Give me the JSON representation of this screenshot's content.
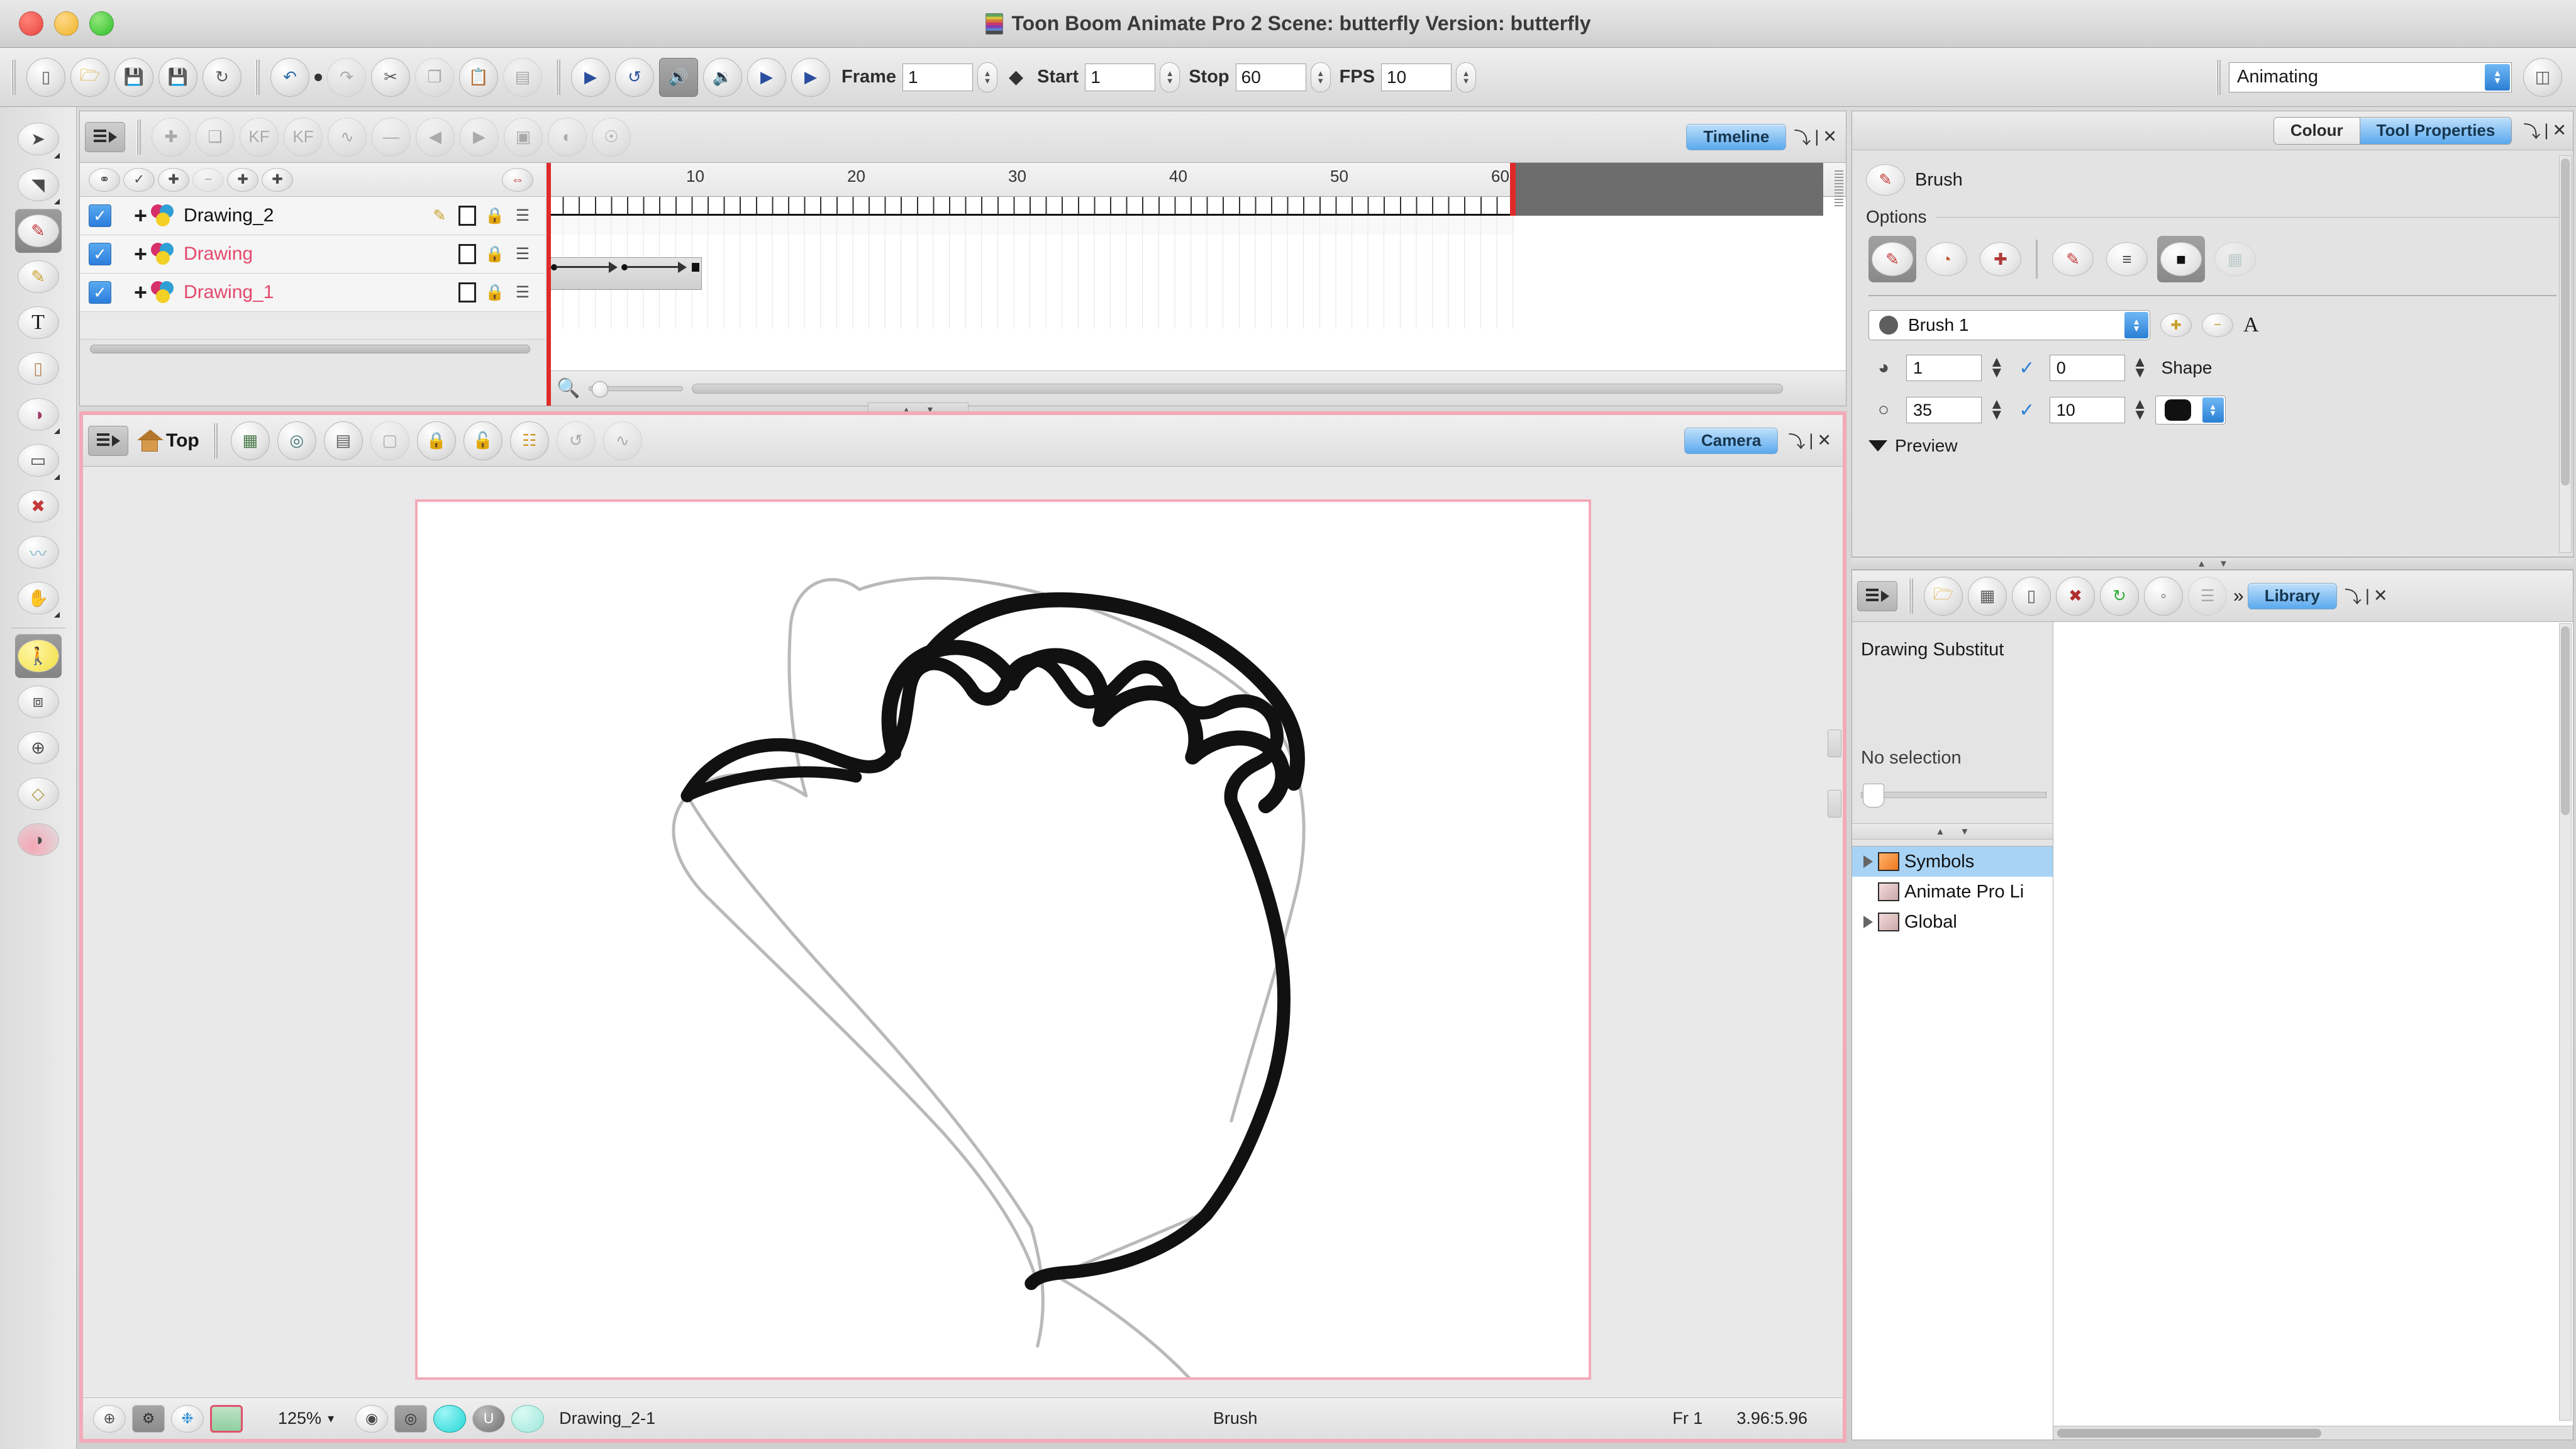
{
  "window": {
    "title": "Toon Boom Animate Pro 2 Scene: butterfly Version: butterfly",
    "close_label": "close",
    "minimize_label": "minimize",
    "zoom_label": "zoom"
  },
  "toolbar": {
    "file_buttons": [
      {
        "name": "new-scene-icon",
        "glyph": "▭"
      },
      {
        "name": "open-scene-icon",
        "glyph": "🗁"
      },
      {
        "name": "save-icon",
        "glyph": "💾"
      },
      {
        "name": "save-as-icon",
        "glyph": "💾"
      },
      {
        "name": "save-all-icon",
        "glyph": "↻"
      }
    ],
    "edit_buttons": [
      {
        "name": "undo-icon",
        "glyph": "↶"
      },
      {
        "name": "redo-icon",
        "glyph": "↷"
      },
      {
        "name": "cut-icon",
        "glyph": "✂"
      },
      {
        "name": "copy-icon",
        "glyph": "❐"
      },
      {
        "name": "paste-icon",
        "glyph": "📋"
      },
      {
        "name": "paste-special-icon",
        "glyph": "▤"
      }
    ],
    "playback_buttons": [
      {
        "name": "play-icon",
        "glyph": "▶",
        "active": false
      },
      {
        "name": "loop-icon",
        "glyph": "↺",
        "active": false
      },
      {
        "name": "sound-on-icon",
        "glyph": "🔊",
        "active": true
      },
      {
        "name": "sound-scrub-icon",
        "glyph": "🔉",
        "active": false
      },
      {
        "name": "preroll-icon",
        "glyph": "▶",
        "active": false
      },
      {
        "name": "postroll-icon",
        "glyph": "▶",
        "active": false
      }
    ],
    "frame_label": "Frame",
    "frame_value": "1",
    "start_label": "Start",
    "start_value": "1",
    "stop_label": "Stop",
    "stop_value": "60",
    "fps_label": "FPS",
    "fps_value": "10",
    "mode_value": "Animating",
    "workspace_icon": "workspace-icon"
  },
  "left_tools": [
    {
      "name": "select-tool",
      "glyph": "➤",
      "active": false,
      "corner": true
    },
    {
      "name": "contour-editor-tool",
      "glyph": "✐",
      "active": false,
      "corner": true
    },
    {
      "name": "brush-tool",
      "glyph": "🖌",
      "active": true,
      "corner": false
    },
    {
      "name": "pencil-tool",
      "glyph": "✎",
      "active": false,
      "corner": false
    },
    {
      "name": "text-tool",
      "glyph": "T",
      "active": false,
      "corner": false
    },
    {
      "name": "eraser-tool",
      "glyph": "⌫",
      "active": false,
      "corner": false
    },
    {
      "name": "paint-tool",
      "glyph": "◕",
      "active": false,
      "corner": true
    },
    {
      "name": "shape-tool",
      "glyph": "▭",
      "active": false,
      "corner": true
    },
    {
      "name": "dropper-tool",
      "glyph": "💉",
      "active": false,
      "corner": false
    },
    {
      "name": "smooth-editor-tool",
      "glyph": "〰",
      "active": false,
      "corner": false
    },
    {
      "name": "grabber-tool",
      "glyph": "✋",
      "active": false,
      "corner": true
    },
    {
      "name": "animate-tool",
      "glyph": "🏃",
      "active": true,
      "corner": false
    },
    {
      "name": "transform-tool",
      "glyph": "⧉",
      "active": false,
      "corner": false
    },
    {
      "name": "pivot-tool",
      "glyph": "⊕",
      "active": false,
      "corner": false
    },
    {
      "name": "perspective-tool",
      "glyph": "◇",
      "active": false,
      "corner": false
    },
    {
      "name": "onion-skin-tool",
      "glyph": "◑",
      "active": false,
      "corner": false
    }
  ],
  "timeline": {
    "tab_label": "Timeline",
    "menu_button": "panel-menu",
    "toolbar_icons": [
      "add-keyframe-exposure-icon",
      "duplicate-drawing-icon",
      "add-keyframe-icon",
      "remove-keyframe-icon",
      "toggle-ease-icon",
      "set-constant-icon",
      "previous-keyframe-icon",
      "next-keyframe-icon"
    ],
    "layer_head_icons": [
      "onion-skin-icon",
      "show-hide-icon",
      "add-layer-icon",
      "delete-layer-icon",
      "add-colour-layer-icon",
      "add-peg-icon"
    ],
    "expand_icon": "expand-collapse-icon",
    "layers": [
      {
        "name": "Drawing_2",
        "enabled": true,
        "red": false,
        "locked": false,
        "has_pencil": true
      },
      {
        "name": "Drawing",
        "enabled": true,
        "red": true,
        "locked": true,
        "has_pencil": false
      },
      {
        "name": "Drawing_1",
        "enabled": true,
        "red": true,
        "locked": true,
        "has_pencil": false
      }
    ],
    "ruler_ticks": [
      "10",
      "20",
      "30",
      "40",
      "50",
      "60"
    ],
    "playhead_frame": "1",
    "zoom_icon": "magnifier-icon",
    "flip_icon": "flip-icon"
  },
  "camera": {
    "tab_label": "Camera",
    "view_label": "Top",
    "menu_button": "panel-menu",
    "toolbar_icons": [
      "grid-icon",
      "show-grid-icon",
      "light-table-icon",
      "onion-skin-icon",
      "lock-icon",
      "unlock-icon",
      "ruler-icon",
      "rotate-icon",
      "morph-icon"
    ],
    "status": {
      "icons_left": [
        "rotate-view-icon",
        "settings-icon",
        "colour-wheel-icon",
        "thumbnail-icon"
      ],
      "zoom_value": "125%",
      "zoom_dropdown": "▾",
      "icons_mid": [
        "onion-marker-icon",
        "light-table-icon",
        "cyan-dot-icon",
        "u-dot-icon",
        "pale-dot-icon"
      ],
      "drawing_name": "Drawing_2-1",
      "tool_name": "Brush",
      "frame_label": "Fr 1",
      "coords": "3.96:5.96"
    }
  },
  "tool_properties": {
    "tabs": [
      {
        "label": "Colour",
        "active": false
      },
      {
        "label": "Tool Properties",
        "active": true
      }
    ],
    "tool_name": "Brush",
    "tool_icon": "brush-icon",
    "options_label": "Options",
    "option_buttons": [
      {
        "name": "draw-behind-option",
        "glyph": "🖌",
        "active": true
      },
      {
        "name": "auto-flatten-option",
        "glyph": "◔",
        "active": false
      },
      {
        "name": "auto-fill-option",
        "glyph": "✚",
        "active": false
      },
      {
        "name": "repaint-brush-option",
        "glyph": "🖌",
        "active": false
      },
      {
        "name": "auto-gap-close-option",
        "glyph": "≡",
        "active": false
      },
      {
        "name": "draw-on-top-option",
        "glyph": "■",
        "active": true
      },
      {
        "name": "create-colour-art-option",
        "glyph": "▦",
        "active": false,
        "dim": true
      }
    ],
    "preset_value": "Brush 1",
    "preset_add_icon": "add-preset-icon",
    "preset_remove_icon": "remove-preset-icon",
    "preset_rename_icon": "A",
    "min_size_icon": "minimum-size-icon",
    "min_size_value": "1",
    "smoothness_icon": "smoothness-icon",
    "smoothness_value": "0",
    "shape_label": "Shape",
    "max_size_icon": "maximum-size-icon",
    "max_size_value": "35",
    "contour_icon": "contour-optimization-icon",
    "contour_value": "10",
    "shape_swatch": "round-tip",
    "preview_label": "Preview"
  },
  "library": {
    "tab_label": "Library",
    "menu_button": "panel-menu",
    "toolbar_icons": [
      "open-library-icon",
      "new-template-icon",
      "new-folder-icon",
      "delete-icon",
      "refresh-icon",
      "properties-icon",
      "more-icon"
    ],
    "more_glyph": "»",
    "drawing_substitution_label": "Drawing Substitut",
    "no_selection_label": "No selection",
    "tree": [
      {
        "label": "Symbols",
        "selected": true,
        "expandable": true,
        "kind": "symbols"
      },
      {
        "label": "Animate Pro Li",
        "selected": false,
        "expandable": false,
        "kind": "library"
      },
      {
        "label": "Global",
        "selected": false,
        "expandable": true,
        "kind": "library"
      }
    ]
  },
  "colors": {
    "accent_blue": "#2a7fd4",
    "selection_blue": "#a8d3f5",
    "layer_red": "#e4486b",
    "playhead_red": "#e02a2a",
    "camera_frame_pink": "#f3aab8"
  }
}
